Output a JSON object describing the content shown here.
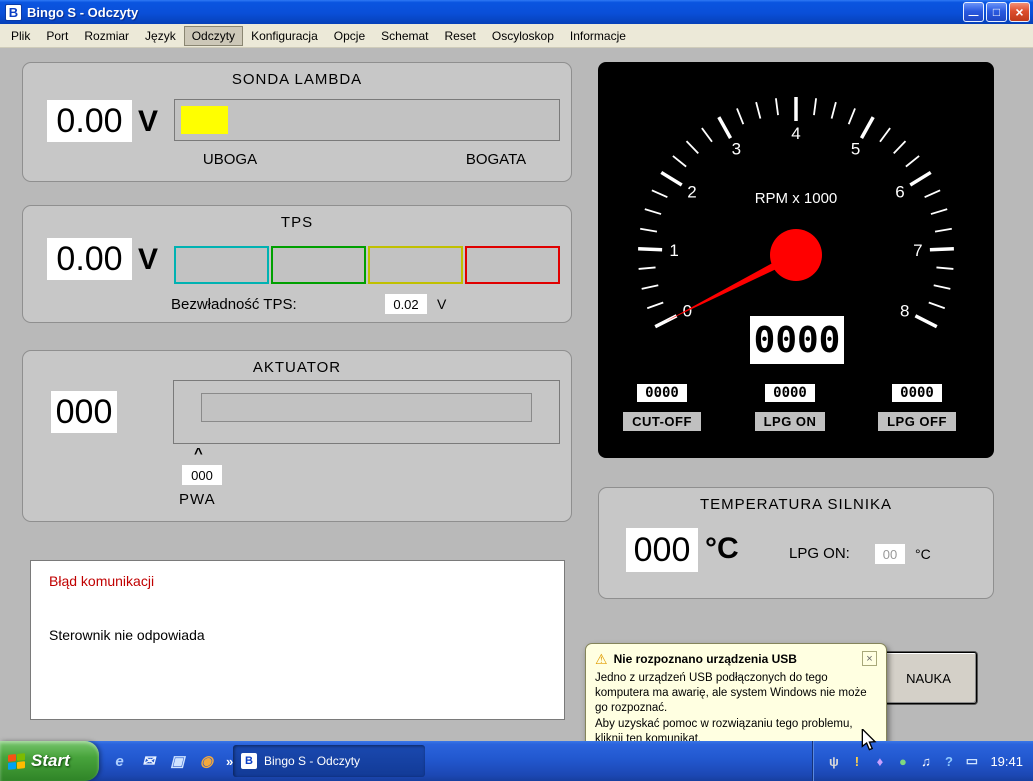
{
  "colors": {
    "lambda_bar": "#ffff00",
    "needle": "#ff0000",
    "ball": "#ff0000",
    "error_text": "#c00000"
  },
  "window": {
    "title": "Bingo S - Odczyty",
    "icon_letter": "B",
    "controls": {
      "minimize": "—",
      "maximize": "□",
      "close": "×"
    }
  },
  "menu": {
    "items": [
      "Plik",
      "Port",
      "Rozmiar",
      "Język",
      "Odczyty",
      "Konfiguracja",
      "Opcje",
      "Schemat",
      "Reset",
      "Oscyloskop",
      "Informacje"
    ],
    "active_item": "Odczyty"
  },
  "panels": {
    "lambda": {
      "title": "SONDA LAMBDA",
      "value": "0.00",
      "unit": "V",
      "label_left": "UBOGA",
      "label_right": "BOGATA"
    },
    "tps": {
      "title": "TPS",
      "value": "0.00",
      "unit": "V",
      "inertia_label": "Bezwładność TPS:",
      "inertia_value": "0.02",
      "inertia_unit": "V",
      "segment_colors": [
        "#00b2b2",
        "#00a000",
        "#c0c000",
        "#e00000"
      ]
    },
    "actuator": {
      "title": "AKTUATOR",
      "value": "000",
      "marker": "^",
      "pwa_value": "000",
      "pwa_label": "PWA"
    },
    "message": {
      "title": "Błąd komunikacji",
      "body": "Sterownik nie odpowiada"
    },
    "rpm": {
      "label": "RPM x 1000",
      "scale": [
        "0",
        "1",
        "2",
        "3",
        "4",
        "5",
        "6",
        "7",
        "8"
      ],
      "needle_value": 0,
      "value": "0000",
      "counters": [
        {
          "value": "0000",
          "label": "CUT-OFF"
        },
        {
          "value": "0000",
          "label": "LPG ON"
        },
        {
          "value": "0000",
          "label": "LPG OFF"
        }
      ]
    },
    "temperature": {
      "title": "TEMPERATURA SILNIKA",
      "value": "000",
      "unit": "°C",
      "lpg_label": "LPG ON:",
      "lpg_value": "00",
      "lpg_unit": "°C"
    },
    "nauka_button": "NAUKA"
  },
  "balloon": {
    "icon": "⚠",
    "title": "Nie rozpoznano urządzenia USB",
    "close": "×",
    "lines": [
      "Jedno z urządzeń USB podłączonych do tego komputera ma awarię, ale system Windows nie może go rozpoznać.",
      "Aby uzyskać pomoc w rozwiązaniu tego problemu, kliknij ten komunikat."
    ]
  },
  "taskbar": {
    "start_label": "Start",
    "quick_launch": [
      {
        "name": "internet-explorer-icon",
        "glyph": "e",
        "color": "#aecfff"
      },
      {
        "name": "mail-icon",
        "glyph": "✉",
        "color": "#e9f2ff"
      },
      {
        "name": "show-desktop-icon",
        "glyph": "▣",
        "color": "#cfe3ff"
      },
      {
        "name": "media-player-icon",
        "glyph": "◉",
        "color": "#f5a93c"
      }
    ],
    "overflow": "»",
    "task_label": "Bingo S - Odczyty",
    "task_icon": "B",
    "tray_icons": [
      {
        "name": "usb-plug-icon",
        "glyph": "ψ",
        "color": "#d8d8d8"
      },
      {
        "name": "device-warning-icon",
        "glyph": "!",
        "color": "#ffd24a"
      },
      {
        "name": "agent-icon",
        "glyph": "♦",
        "color": "#c9a0ff"
      },
      {
        "name": "antivirus-icon",
        "glyph": "●",
        "color": "#7fd87f"
      },
      {
        "name": "volume-icon",
        "glyph": "♫",
        "color": "#ffffff"
      },
      {
        "name": "help-icon",
        "glyph": "?",
        "color": "#8fc8ff"
      },
      {
        "name": "display-icon",
        "glyph": "▭",
        "color": "#cfe4ff"
      }
    ],
    "clock": "19:41"
  }
}
